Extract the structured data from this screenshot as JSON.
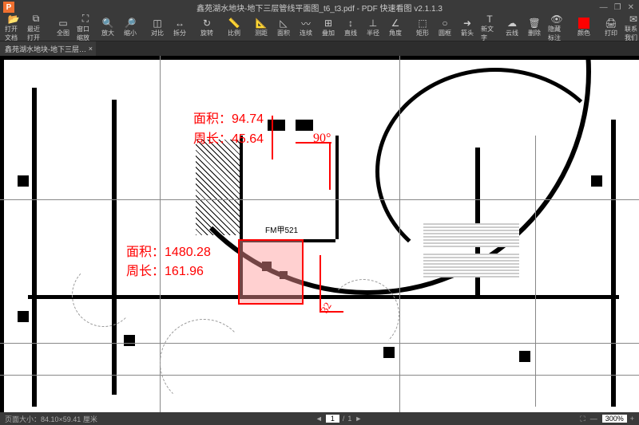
{
  "app": {
    "title": "鑫苑湖水地块-地下三层管线平面图_t6_t3.pdf - PDF 快速看图 v2.1.1.3",
    "logo_letter": "P"
  },
  "window_controls": {
    "min": "—",
    "max": "❐",
    "close": "✕"
  },
  "toolbar": [
    {
      "icon": "📂",
      "label": "打开文档"
    },
    {
      "icon": "⧉",
      "label": "最近打开"
    },
    {
      "sep": true
    },
    {
      "icon": "▭",
      "label": "全图"
    },
    {
      "icon": "⛶",
      "label": "窗口缩放"
    },
    {
      "icon": "🔍",
      "label": "放大"
    },
    {
      "icon": "🔎",
      "label": "缩小"
    },
    {
      "sep": true
    },
    {
      "icon": "◫",
      "label": "对比"
    },
    {
      "icon": "↔",
      "label": "拆分"
    },
    {
      "sep": true
    },
    {
      "icon": "↻",
      "label": "旋转"
    },
    {
      "sep": true
    },
    {
      "icon": "📏",
      "label": "比例"
    },
    {
      "sep": true
    },
    {
      "icon": "📐",
      "label": "测距"
    },
    {
      "icon": "◺",
      "label": "面积"
    },
    {
      "icon": "〰",
      "label": "连续"
    },
    {
      "icon": "⊞",
      "label": "叠加"
    },
    {
      "icon": "↕",
      "label": "直线"
    },
    {
      "icon": "⊥",
      "label": "半径"
    },
    {
      "icon": "∠",
      "label": "角度"
    },
    {
      "sep": true
    },
    {
      "icon": "⬚",
      "label": "矩形"
    },
    {
      "icon": "○",
      "label": "圆框"
    },
    {
      "icon": "➜",
      "label": "箭头"
    },
    {
      "icon": "T",
      "label": "新文字"
    },
    {
      "icon": "☁",
      "label": "云线"
    },
    {
      "icon": "🗑",
      "label": "删除"
    },
    {
      "icon": "👁",
      "label": "隐藏标注"
    },
    {
      "sep": true
    },
    {
      "icon": "■",
      "label": "颜色",
      "color": "#ff0000"
    },
    {
      "sep": true
    },
    {
      "icon": "🖨",
      "label": "打印"
    },
    {
      "icon": "✉",
      "label": "联系我们"
    }
  ],
  "tab": {
    "label": "鑫苑湖水地块-地下三层…",
    "close": "×"
  },
  "annotations": {
    "area1_label": "面积：",
    "area1_value": "94.74",
    "perim1_label": "周长：",
    "perim1_value": "45.64",
    "angle_label": "90°",
    "area2_label": "面积：",
    "area2_value": "1480.28",
    "perim2_label": "周长：",
    "perim2_value": "161.96",
    "dim32": "32"
  },
  "drawing_labels": {
    "fm": "FM甲521"
  },
  "statusbar": {
    "page_size_label": "页面大小：",
    "page_size_value": "84.10×59.41 厘米",
    "page_current": "1",
    "page_sep": "/",
    "page_total": "1",
    "fit": "⛶",
    "minus": "—",
    "zoom": "300%",
    "plus": "+"
  }
}
